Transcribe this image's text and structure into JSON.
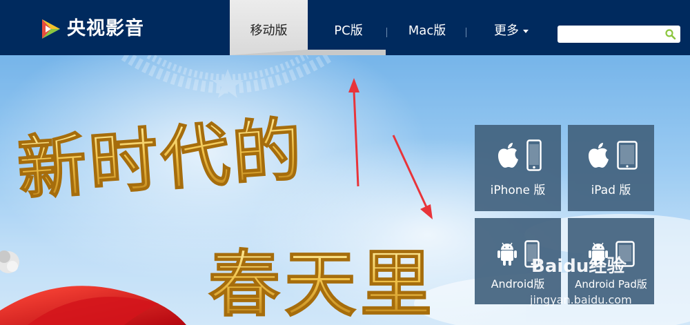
{
  "header": {
    "logo_text": "央视影音",
    "nav": {
      "mobile": "移动版",
      "pc": "PC版",
      "mac": "Mac版",
      "more": "更多"
    },
    "search": {
      "placeholder": "",
      "value": ""
    }
  },
  "hero": {
    "headline_line1": "新时代的",
    "headline_line2": "春天里"
  },
  "downloads": {
    "iphone": "iPhone 版",
    "ipad": "iPad 版",
    "android_phone": "Android版",
    "android_pad": "Android Pad版"
  },
  "watermark": {
    "brand": "Baidu经验",
    "url": "jingyan.baidu.com"
  },
  "colors": {
    "header_bg": "#002a5e",
    "tile_bg": "#42627e",
    "search_icon": "#8cc63f",
    "arrow": "#e8343a",
    "headline_gold": "#e9b339"
  },
  "icons": [
    "logo-mark-icon",
    "search-icon",
    "apple-icon",
    "phone-icon",
    "tablet-icon",
    "android-icon",
    "caret-down-icon"
  ]
}
